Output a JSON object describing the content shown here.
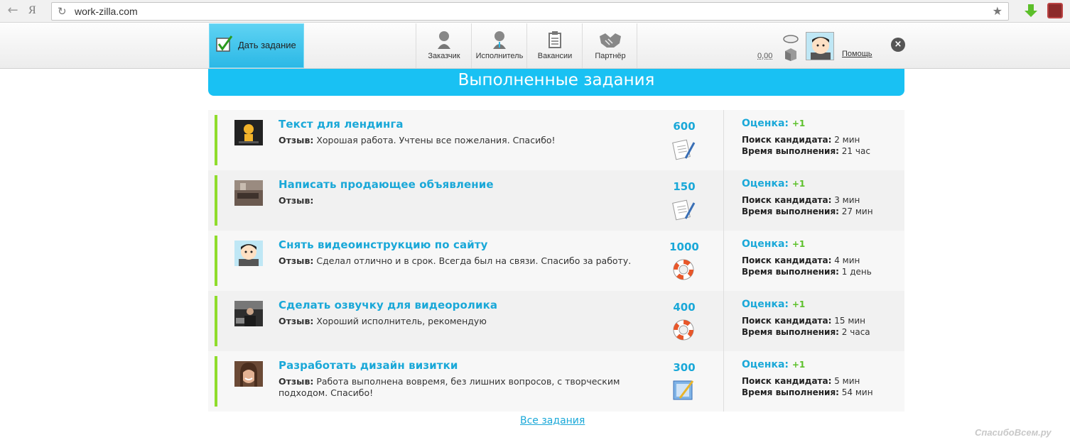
{
  "browser": {
    "url": "work-zilla.com",
    "ya_label": "Я"
  },
  "header": {
    "give_task_label": "Дать задание",
    "nav": [
      {
        "label": "Заказчик"
      },
      {
        "label": "Исполнитель"
      },
      {
        "label": "Вакансии"
      },
      {
        "label": "Партнёр"
      }
    ],
    "balance": "0,00",
    "help_label": "Помощь"
  },
  "banner": {
    "title": "Выполненные задания"
  },
  "tasks": [
    {
      "title": "Текст для лендинга",
      "review_label": "Отзыв:",
      "review_text": "Хорошая работа. Учтены все пожелания. Спасибо!",
      "price": "600",
      "type_icon": "document-icon",
      "rating_label": "Оценка:",
      "rating_value": "+1",
      "search_label": "Поиск кандидата:",
      "search_value": "2 мин",
      "exec_label": "Время выполнения:",
      "exec_value": "21 час"
    },
    {
      "title": "Написать продающее объявление",
      "review_label": "Отзыв:",
      "review_text": "",
      "price": "150",
      "type_icon": "document-icon",
      "rating_label": "Оценка:",
      "rating_value": "+1",
      "search_label": "Поиск кандидата:",
      "search_value": "3 мин",
      "exec_label": "Время выполнения:",
      "exec_value": "27 мин"
    },
    {
      "title": "Снять видеоинструкцию по сайту",
      "review_label": "Отзыв:",
      "review_text": "Сделал отлично и в срок. Всегда был на связи. Спасибо за работу.",
      "price": "1000",
      "type_icon": "lifebuoy-icon",
      "rating_label": "Оценка:",
      "rating_value": "+1",
      "search_label": "Поиск кандидата:",
      "search_value": "4 мин",
      "exec_label": "Время выполнения:",
      "exec_value": "1 день"
    },
    {
      "title": "Сделать озвучку для видеоролика",
      "review_label": "Отзыв:",
      "review_text": "Хороший исполнитель, рекомендую",
      "price": "400",
      "type_icon": "lifebuoy-icon",
      "rating_label": "Оценка:",
      "rating_value": "+1",
      "search_label": "Поиск кандидата:",
      "search_value": "15 мин",
      "exec_label": "Время выполнения:",
      "exec_value": "2 часа"
    },
    {
      "title": "Разработать дизайн визитки",
      "review_label": "Отзыв:",
      "review_text": "Работа выполнена вовремя, без лишних вопросов, с творческим подходом. Спасибо!",
      "price": "300",
      "type_icon": "design-icon",
      "rating_label": "Оценка:",
      "rating_value": "+1",
      "search_label": "Поиск кандидата:",
      "search_value": "5 мин",
      "exec_label": "Время выполнения:",
      "exec_value": "54 мин"
    }
  ],
  "footer": {
    "all_tasks_label": "Все задания",
    "watermark": "СпасибоВсем.ру"
  },
  "colors": {
    "accent": "#19c1f3",
    "title": "#1aa8d8",
    "green_bar": "#8fdc2c",
    "plus": "#5cc02a"
  }
}
